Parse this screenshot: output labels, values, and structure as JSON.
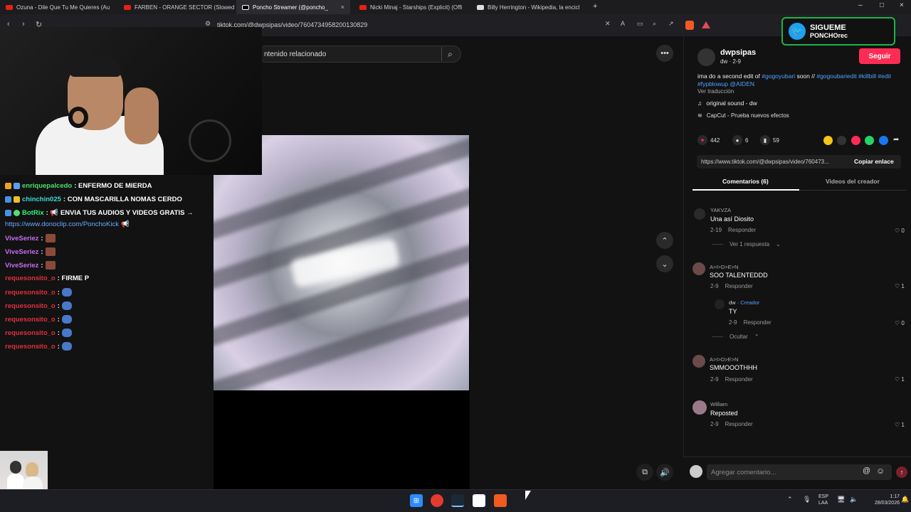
{
  "browser": {
    "tabs": [
      {
        "label": "Ozuna - Dile Que Tu Me Quieres (Au",
        "close": "×"
      },
      {
        "label": "FARBEN - ORANGE SECTOR (Slowed",
        "close": "×"
      },
      {
        "label": "Poncho Streamer (@poncho_",
        "close": "×"
      },
      {
        "label": "Nicki Minaj - Starships (Explicit) (Offi",
        "close": "×"
      },
      {
        "label": "Billy Herrington - Wikipedia, la encicl",
        "close": "×"
      }
    ],
    "new_tab": "+",
    "url": "tiktok.com/@dwpsipas/video/7604734958200130829",
    "window_controls": {
      "minimize": "–",
      "maximize": "□",
      "close": "×"
    }
  },
  "tiktok": {
    "search_placeholder": "ntenido relacionado",
    "more_button": "•••",
    "nav_up": "⌃",
    "nav_down": "⌄",
    "author": {
      "username": "dwpsipas",
      "subline": "dw · 2-9",
      "follow_label": "Seguir"
    },
    "description": {
      "text1": "ima do a second edit of",
      "tag1": "#gogoyubari",
      "text2": "soon //",
      "tag2": "#gogoubariedit",
      "tag3": "#killbill",
      "tag4": "#edit",
      "tag5": "#fypblowup",
      "tag6": "@AIDEN",
      "translate": "Ver traducción"
    },
    "sound": "original sound - dw",
    "effect": "CapCut - Prueba nuevos efectos",
    "stats": {
      "likes": "442",
      "comments": "6",
      "saves": "59"
    },
    "link": {
      "url": "https://www.tiktok.com/@dwpsipas/video/760473...",
      "copy_label": "Copiar enlace"
    },
    "tabs": {
      "comments": "Comentarios (6)",
      "creator_videos": "Videos del creador"
    },
    "comments": [
      {
        "name": "YAKVZA",
        "text": "Una así Diosito",
        "date": "2-19",
        "reply": "Responder",
        "likes": "0",
        "view_replies": "Ver 1 respuesta"
      },
      {
        "name": "A>I>D>E>N",
        "text": "SOO TALENTEDDD",
        "date": "2-9",
        "reply": "Responder",
        "likes": "1"
      },
      {
        "name": "dw",
        "creator_tag": "Creador",
        "text": "TY",
        "date": "2-9",
        "reply": "Responder",
        "likes": "0",
        "hide": "Ocultar"
      },
      {
        "name": "A>I>D>E>N",
        "text": "SMMOOOTHHH",
        "date": "2-9",
        "reply": "Responder",
        "likes": "1"
      },
      {
        "name": "William",
        "text": "Reposted",
        "date": "2-9",
        "reply": "Responder",
        "likes": "1"
      }
    ],
    "comment_placeholder": "Agregar comentario...",
    "comment_at": "@",
    "comment_emoji": "☺"
  },
  "stream": {
    "banner_line1": "SIGUEME",
    "banner_line2": "PONCHOrec",
    "chat": [
      {
        "user": "enriquepalcedo",
        "user_color": "#4fe06f",
        "msg": ": ENFERMO DE MIERDA"
      },
      {
        "user": "chinchin025",
        "user_color": "#3ddad7",
        "msg": ": CON MASCARILLA NOMAS CERDO"
      },
      {
        "user": "BotRix",
        "user_color": "#2ff57a",
        "msg": ": 📢 ENVIA TUS AUDIOS Y VIDEOS GRATIS →"
      },
      {
        "link": "https://www.donoclip.com/PonchoKick"
      },
      {
        "user": "ViveSeriez",
        "user_color": "#c66cf0",
        "msg": ":"
      },
      {
        "user": "ViveSeriez",
        "user_color": "#c66cf0",
        "msg": ":"
      },
      {
        "user": "ViveSeriez",
        "user_color": "#c66cf0",
        "msg": ":"
      },
      {
        "user": "requesonsito_o",
        "user_color": "#e0303c",
        "msg": ": FIRME P"
      },
      {
        "user": "requesonsito_o",
        "user_color": "#e0303c",
        "msg": ":"
      },
      {
        "user": "requesonsito_o",
        "user_color": "#e0303c",
        "msg": ":"
      },
      {
        "user": "requesonsito_o",
        "user_color": "#e0303c",
        "msg": ":"
      },
      {
        "user": "requesonsito_o",
        "user_color": "#e0303c",
        "msg": ":"
      },
      {
        "user": "requesonsito_o",
        "user_color": "#e0303c",
        "msg": ":"
      }
    ]
  },
  "taskbar": {
    "lang": "ESP",
    "lang2": "LAA",
    "time": "1:17",
    "date": "28/03/2026"
  },
  "colors": {
    "accent": "#fe2c55",
    "link": "#4ea3ff"
  }
}
